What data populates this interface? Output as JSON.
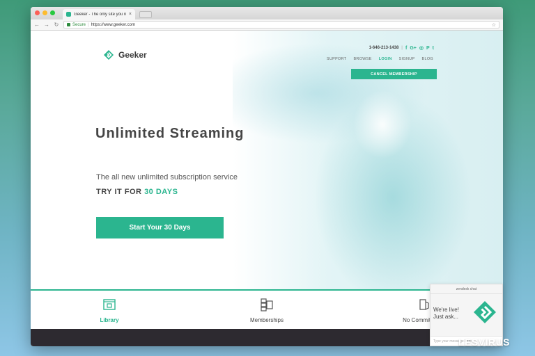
{
  "browser": {
    "tab_title": "Geeker - The only site you ne...",
    "tab_close": "×",
    "back": "←",
    "forward": "→",
    "reload": "↻",
    "secure_label": "Secure",
    "url": "https://www.geeker.com",
    "bookmark": "☆"
  },
  "site": {
    "brand": "Geeker",
    "phone": "1-646-213-1438",
    "social": [
      "f",
      "G+",
      "◎",
      "P",
      "t"
    ],
    "nav": [
      "SUPPORT",
      "BROWSE",
      "LOGIN",
      "SIGNUP",
      "BLOG"
    ],
    "nav_active": "LOGIN",
    "cancel_button": "CANCEL MEMBERSHIP",
    "accent_color": "#2bb58f"
  },
  "hero": {
    "headline": "Unlimited Streaming",
    "subline": "The all new unlimited subscription service",
    "trial_prefix": "TRY IT FOR",
    "trial_highlight": "30 DAYS",
    "cta": "Start Your 30 Days"
  },
  "features": [
    {
      "label": "Library",
      "icon": "library-icon",
      "active": true
    },
    {
      "label": "Memberships",
      "icon": "memberships-icon",
      "active": false
    },
    {
      "label": "No Commitments",
      "icon": "no-commitments-icon",
      "active": false
    }
  ],
  "chat": {
    "title": "zendesk chat",
    "message_line1": "We're live!",
    "message_line2": "Just ask...",
    "input_placeholder": "Type your message here"
  },
  "watermark": "LESVIRUS"
}
